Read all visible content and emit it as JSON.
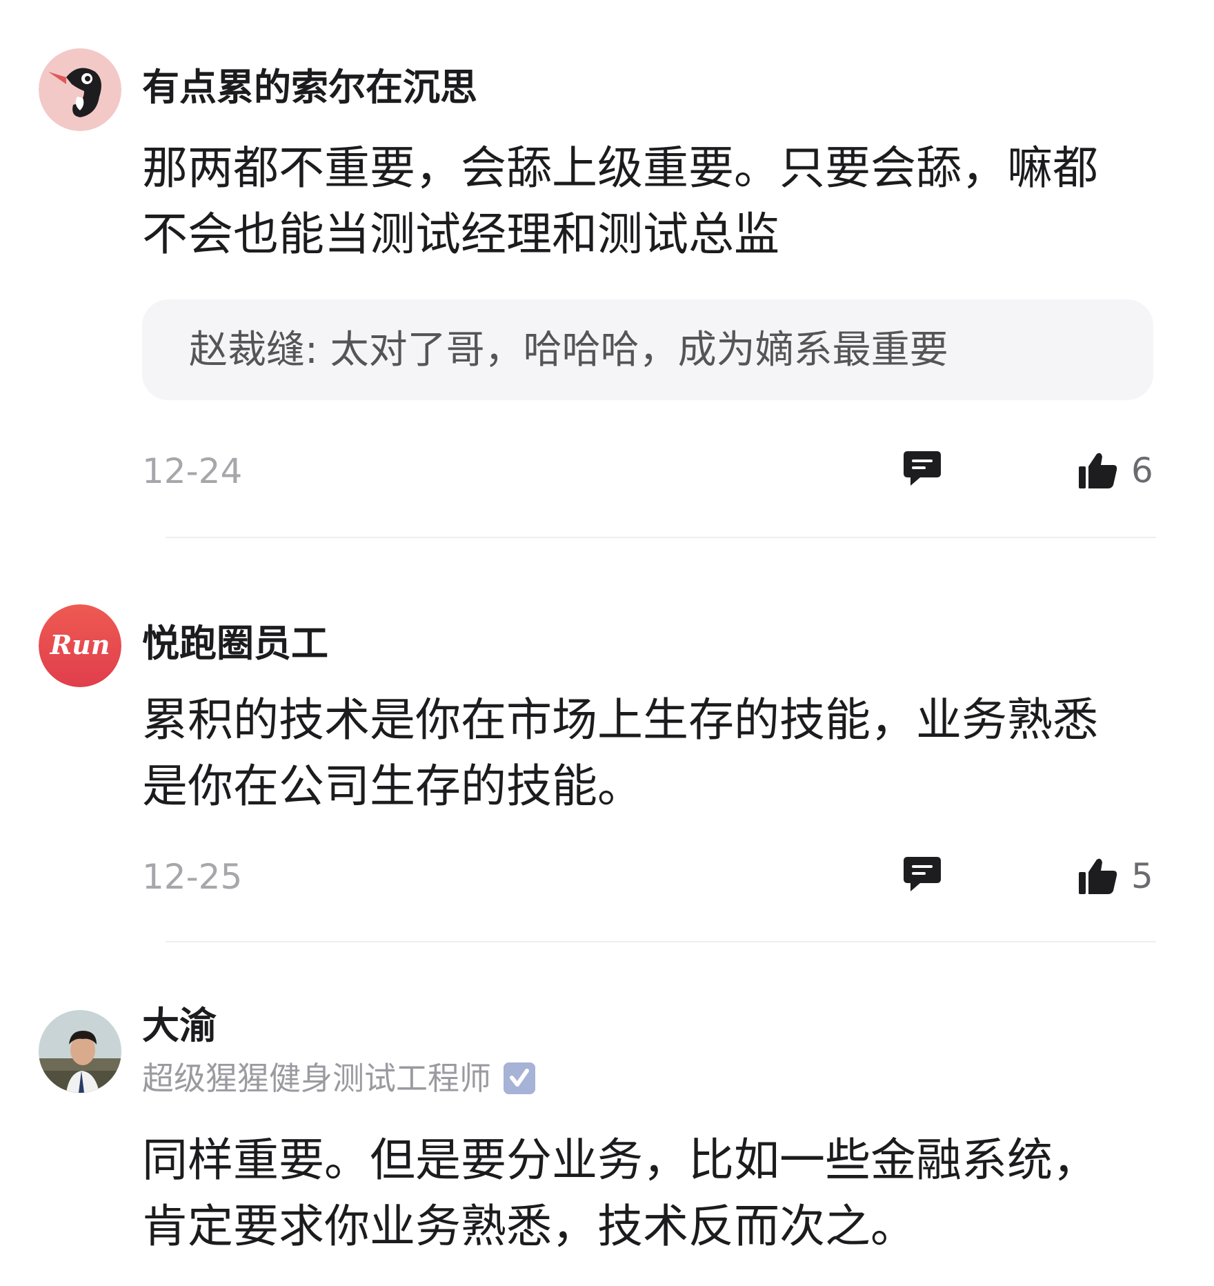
{
  "comments": [
    {
      "avatar": "woodpecker-avatar",
      "username": "有点累的索尔在沉思",
      "content_lines": [
        "那两都不重要，会舔上级重要。只要会舔，嘛都",
        "不会也能当测试经理和测试总监"
      ],
      "reply": {
        "author": "赵裁缝:",
        "text": " 太对了哥，哈哈哈，成为嫡系最重要"
      },
      "date": "12-24",
      "likes": "6"
    },
    {
      "avatar": "run-logo-avatar",
      "avatar_text": "Run",
      "username": "悦跑圈员工",
      "content_lines": [
        "累积的技术是你在市场上生存的技能，业务熟悉",
        "是你在公司生存的技能。"
      ],
      "date": "12-25",
      "likes": "5"
    },
    {
      "avatar": "person-photo-avatar",
      "username": "大渝",
      "subtitle": "超级猩猩健身测试工程师",
      "content_lines": [
        "同样重要。但是要分业务，比如一些金融系统，",
        "肯定要求你业务熟悉，技术反而次之。"
      ]
    }
  ],
  "icons": {
    "comment": "speech-bubble-icon",
    "like": "thumbs-up-icon",
    "verified": "verified-badge-icon"
  },
  "colors": {
    "text_primary": "#1c1c1e",
    "text_secondary": "#9a9aa0",
    "reply_background": "#f5f5f7",
    "avatar1_background": "#f2c9c7",
    "avatar2_background": "#e64a4f",
    "verified_badge": "#a6b2d6"
  }
}
